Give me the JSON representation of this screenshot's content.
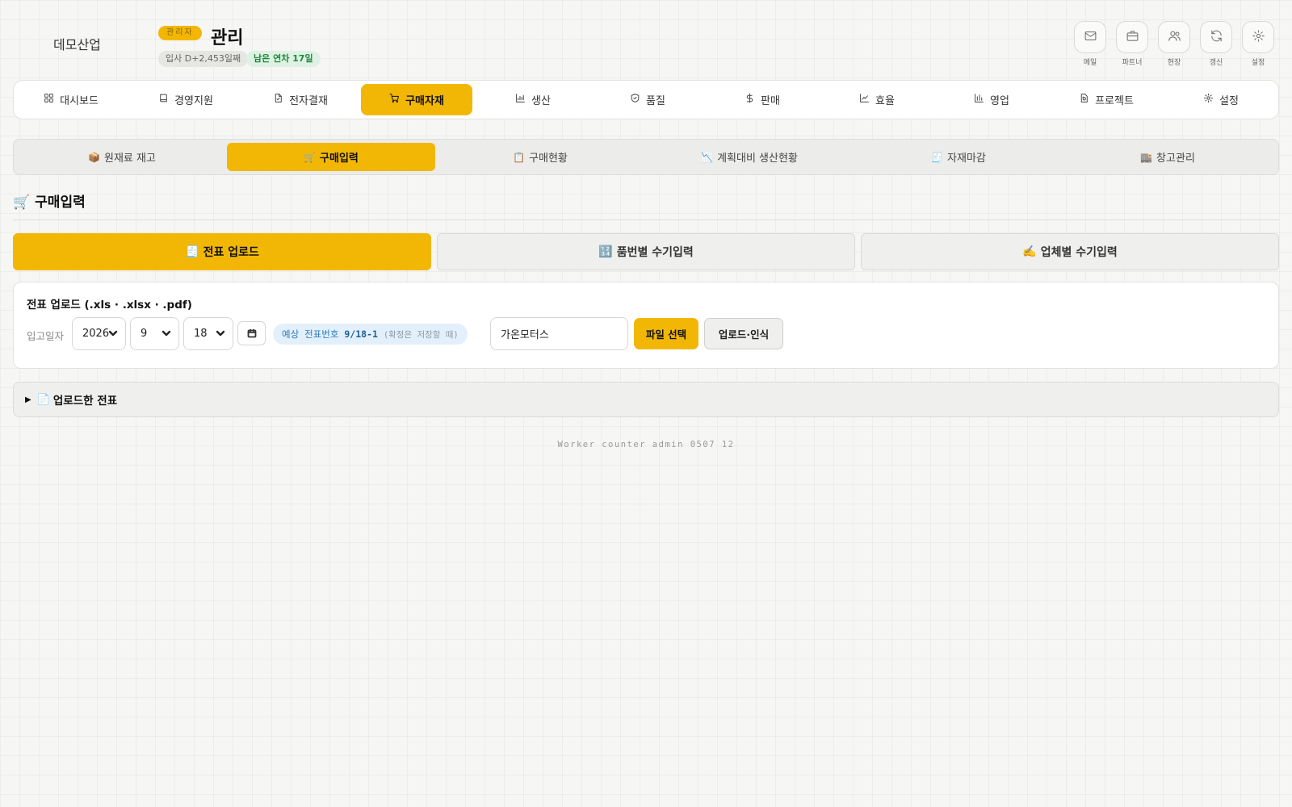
{
  "header": {
    "company_name": "데모산업",
    "role_badge": "관리자",
    "user_name": "관리",
    "join_chip": "입사 D+2,453일째",
    "leave_chip": "남은 연차 17일",
    "actions": [
      {
        "label": "메일",
        "icon": "mail-icon"
      },
      {
        "label": "파트너",
        "icon": "briefcase-icon"
      },
      {
        "label": "현장",
        "icon": "users-icon"
      },
      {
        "label": "갱신",
        "icon": "refresh-icon"
      },
      {
        "label": "설정",
        "icon": "gear-icon"
      }
    ]
  },
  "main_nav": {
    "active_index": 3,
    "items": [
      {
        "label": "대시보드",
        "icon": "grid-icon"
      },
      {
        "label": "경영지원",
        "icon": "book-icon"
      },
      {
        "label": "전자결재",
        "icon": "document-check-icon"
      },
      {
        "label": "구매자재",
        "icon": "cart-icon"
      },
      {
        "label": "생산",
        "icon": "bar-chart-icon"
      },
      {
        "label": "품질",
        "icon": "shield-check-icon"
      },
      {
        "label": "판매",
        "icon": "dollar-icon"
      },
      {
        "label": "효율",
        "icon": "line-chart-icon"
      },
      {
        "label": "영업",
        "icon": "column-chart-icon"
      },
      {
        "label": "프로젝트",
        "icon": "rotate-icon"
      },
      {
        "label": "설정",
        "icon": "gear-icon"
      }
    ]
  },
  "sub_nav": {
    "active_index": 1,
    "items": [
      {
        "emoji": "📦",
        "label": "원재료 재고"
      },
      {
        "emoji": "🛒",
        "label": "구매입력"
      },
      {
        "emoji": "📋",
        "label": "구매현황"
      },
      {
        "emoji": "📉",
        "label": "계획대비 생산현황"
      },
      {
        "emoji": "🧾",
        "label": "자재마감"
      },
      {
        "emoji": "🏬",
        "label": "창고관리"
      }
    ]
  },
  "section": {
    "emoji": "🛒",
    "title": "구매입력"
  },
  "mode_tabs": {
    "active_index": 0,
    "items": [
      {
        "emoji": "🧾",
        "label": "전표 업로드"
      },
      {
        "emoji": "🔢",
        "label": "품번별 수기입력"
      },
      {
        "emoji": "✍️",
        "label": "업체별 수기입력"
      }
    ]
  },
  "upload_card": {
    "title": "전표 업로드 (.xls · .xlsx · .pdf)",
    "date_label": "입고일자",
    "year": "2026",
    "month": "9",
    "day": "18",
    "calendar_icon": "calendar-icon",
    "slip_prefix": "예상 전표번호",
    "slip_number": "9/18-1",
    "slip_note": "(확정은 저장할 때)",
    "vendor_value": "가온모터스",
    "file_button": "파일 선택",
    "upload_button": "업로드·인식"
  },
  "uploaded_section": {
    "triangle": "▶",
    "emoji": "📄",
    "label": "업로드한 전표"
  },
  "footer": {
    "text": "Worker counter admin 0507 12"
  },
  "colors": {
    "accent": "#f2b705",
    "background": "#f6f6f4",
    "leave_green": "#1e8a3c",
    "slip_blue": "#2b7bbd"
  }
}
